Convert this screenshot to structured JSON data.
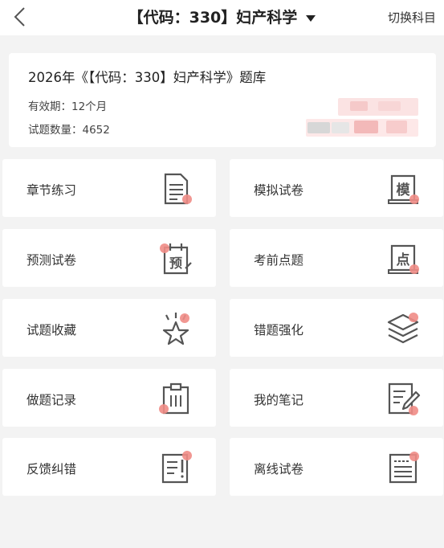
{
  "header": {
    "title": "【代码：330】妇产科学",
    "switch_label": "切换科目"
  },
  "info": {
    "bank_title": "2026年《【代码：330】妇产科学》题库",
    "validity": "有效期：12个月",
    "count": "试题数量：4652"
  },
  "accent_color": "#f08c86",
  "icon_color": "#555555",
  "tiles": [
    {
      "label": "章节练习",
      "icon": "document-icon"
    },
    {
      "label": "模拟试卷",
      "icon": "scroll-mo-icon",
      "icon_text": "模"
    },
    {
      "label": "预测试卷",
      "icon": "calendar-yu-icon",
      "icon_text": "预"
    },
    {
      "label": "考前点题",
      "icon": "scroll-dian-icon",
      "icon_text": "点"
    },
    {
      "label": "试题收藏",
      "icon": "star-icon"
    },
    {
      "label": "错题强化",
      "icon": "layers-icon"
    },
    {
      "label": "做题记录",
      "icon": "clipboard-icon"
    },
    {
      "label": "我的笔记",
      "icon": "note-edit-icon"
    },
    {
      "label": "反馈纠错",
      "icon": "feedback-icon"
    },
    {
      "label": "离线试卷",
      "icon": "offline-paper-icon"
    }
  ]
}
